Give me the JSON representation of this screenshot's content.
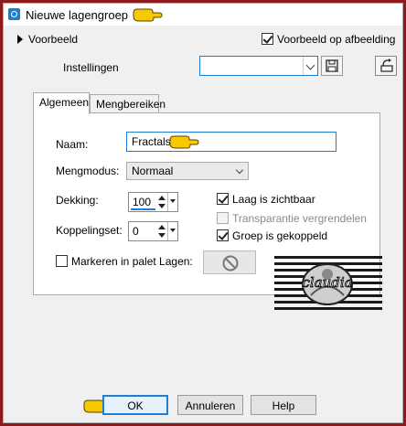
{
  "window": {
    "title": "Nieuwe lagengroep"
  },
  "preview": {
    "label": "Voorbeeld",
    "on_image_label": "Voorbeeld op afbeelding",
    "on_image_checked": true
  },
  "settings": {
    "label": "Instellingen",
    "value": ""
  },
  "tabs": [
    {
      "label": "Algemeen",
      "active": true
    },
    {
      "label": "Mengbereiken",
      "active": false
    }
  ],
  "general": {
    "name_label": "Naam:",
    "name_value": "Fractals",
    "blend_label": "Mengmodus:",
    "blend_value": "Normaal",
    "opacity_label": "Dekking:",
    "opacity_value": "100",
    "link_label": "Koppelingset:",
    "link_value": "0",
    "visible_label": "Laag is zichtbaar",
    "visible_checked": true,
    "lock_transparency_label": "Transparantie vergrendelen",
    "lock_transparency_checked": false,
    "group_linked_label": "Groep is gekoppeld",
    "group_linked_checked": true,
    "highlight_label": "Markeren in palet Lagen:",
    "highlight_checked": false
  },
  "buttons": {
    "ok": "OK",
    "cancel": "Annuleren",
    "help": "Help"
  },
  "watermark": {
    "text": "claudia"
  },
  "colors": {
    "accent": "#1c7ed6",
    "frame": "#8e1b1b",
    "pointer": "#f7c900"
  }
}
